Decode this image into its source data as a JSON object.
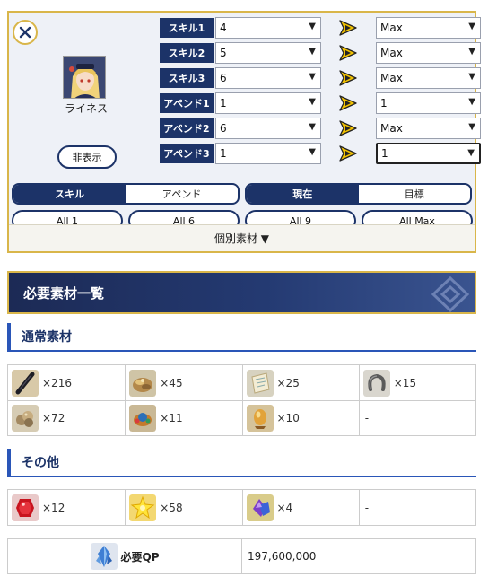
{
  "servant": {
    "name": "ライネス",
    "hide_label": "非表示"
  },
  "skills": [
    {
      "label": "スキル1",
      "current": "4",
      "target": "Max"
    },
    {
      "label": "スキル2",
      "current": "5",
      "target": "Max"
    },
    {
      "label": "スキル3",
      "current": "6",
      "target": "Max"
    },
    {
      "label": "アペンド1",
      "current": "1",
      "target": "1"
    },
    {
      "label": "アペンド2",
      "current": "6",
      "target": "Max"
    },
    {
      "label": "アペンド3",
      "current": "1",
      "target": "1"
    }
  ],
  "toggles": {
    "mode": [
      "スキル",
      "アペンド"
    ],
    "level_type": [
      "現在",
      "目標"
    ]
  },
  "bulk_buttons": [
    "All 1",
    "All 6",
    "All 9",
    "All Max"
  ],
  "individual_materials_label": "個別素材 ▼",
  "required_heading": "必要素材一覧",
  "normal_materials": {
    "title": "通常素材",
    "items": [
      {
        "icon": "black-stick-icon",
        "count": "×216"
      },
      {
        "icon": "coin-pile-icon",
        "count": "×45"
      },
      {
        "icon": "scroll-icon",
        "count": "×25"
      },
      {
        "icon": "horseshoe-icon",
        "count": "×15"
      },
      {
        "icon": "ore-pile-icon",
        "count": "×72"
      },
      {
        "icon": "jewel-crown-icon",
        "count": "×11"
      },
      {
        "icon": "golden-egg-icon",
        "count": "×10"
      },
      {
        "icon": "",
        "count": "-"
      }
    ]
  },
  "other_materials": {
    "title": "その他",
    "items": [
      {
        "icon": "red-gem-icon",
        "count": "×12"
      },
      {
        "icon": "gold-star-icon",
        "count": "×58"
      },
      {
        "icon": "purple-crystal-icon",
        "count": "×4"
      },
      {
        "icon": "",
        "count": "-"
      }
    ]
  },
  "qp": {
    "label": "必要QP",
    "value": "197,600,000"
  },
  "colors": {
    "navy": "#1c3368",
    "gold_border": "#d9b64a",
    "accent_blue": "#2a56b8",
    "arrow_yellow": "#f2c200"
  }
}
